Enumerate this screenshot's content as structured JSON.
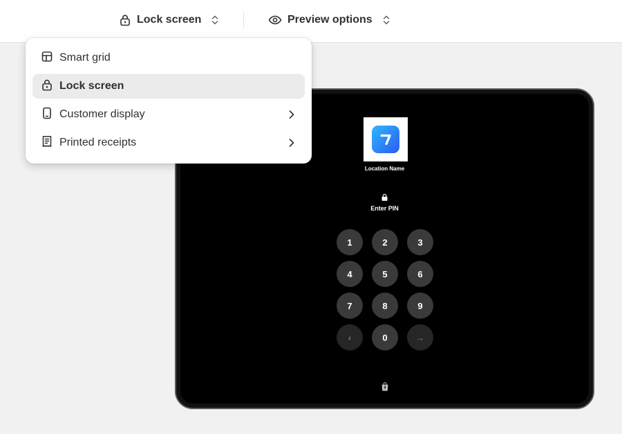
{
  "topbar": {
    "view_selector": {
      "label": "Lock screen",
      "icon": "lock-icon"
    },
    "preview_options": {
      "label": "Preview options",
      "icon": "eye-icon"
    }
  },
  "menu": {
    "items": [
      {
        "label": "Smart grid",
        "icon": "grid-icon",
        "selected": false,
        "has_submenu": false
      },
      {
        "label": "Lock screen",
        "icon": "lock-icon",
        "selected": true,
        "has_submenu": false
      },
      {
        "label": "Customer display",
        "icon": "tablet-icon",
        "selected": false,
        "has_submenu": true
      },
      {
        "label": "Printed receipts",
        "icon": "receipt-icon",
        "selected": false,
        "has_submenu": true
      }
    ]
  },
  "preview": {
    "location_name": "Location Name",
    "prompt": "Enter PIN",
    "keys": [
      "1",
      "2",
      "3",
      "4",
      "5",
      "6",
      "7",
      "8",
      "9",
      "‹",
      "0",
      "→"
    ]
  },
  "colors": {
    "tablet_bg": "#000000",
    "key_bg": "#3a3a3a",
    "menu_selected_bg": "#ebebeb",
    "logo_gradient_start": "#2fb6ff",
    "logo_gradient_end": "#2c5cf0"
  }
}
